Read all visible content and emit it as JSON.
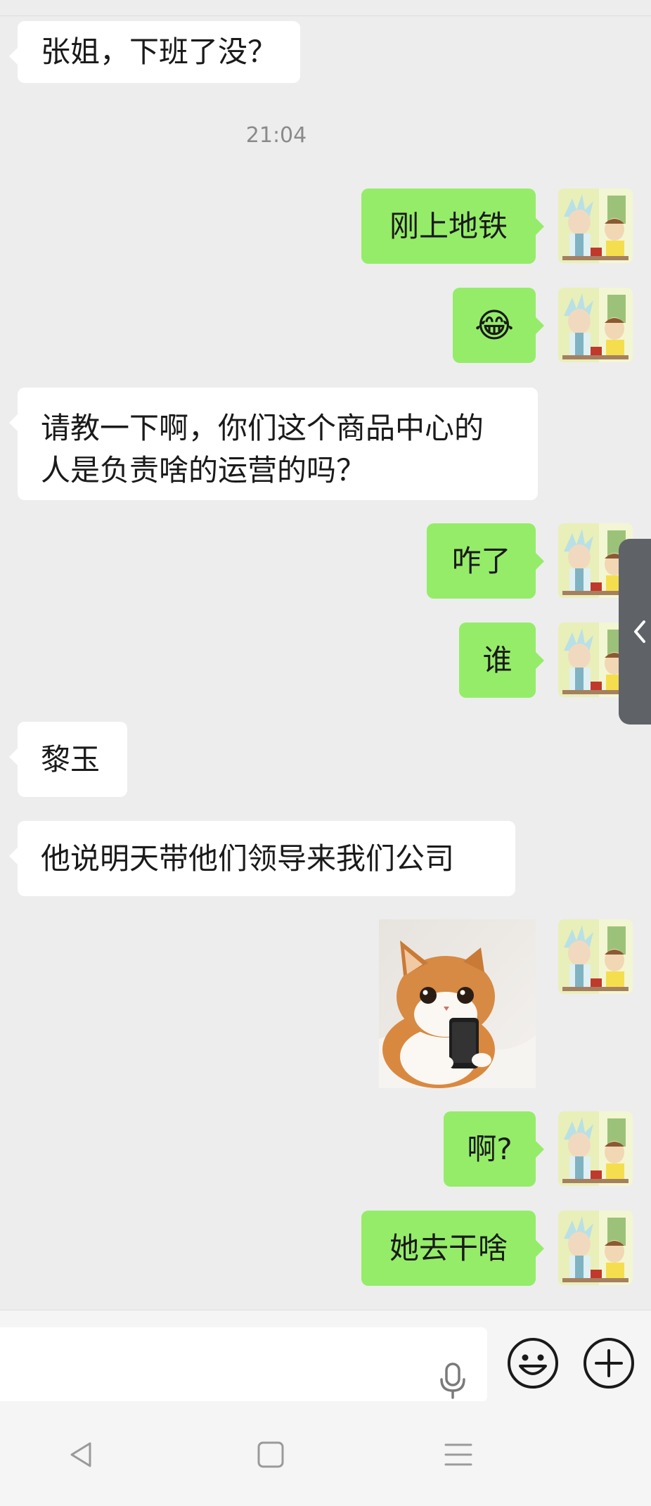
{
  "messages": [
    {
      "type": "text",
      "side": "in",
      "text": "张姐，下班了没？"
    },
    {
      "type": "timestamp",
      "text": "21:04"
    },
    {
      "type": "text",
      "side": "out",
      "text": "刚上地铁"
    },
    {
      "type": "emoji",
      "side": "out",
      "emoji": "😂"
    },
    {
      "type": "text",
      "side": "in",
      "lines": [
        "请教一下啊，你们这个商品中心的",
        "人是负责啥的运营的吗？"
      ]
    },
    {
      "type": "text",
      "side": "out",
      "text": "咋了"
    },
    {
      "type": "text",
      "side": "out",
      "text": "谁"
    },
    {
      "type": "text",
      "side": "in",
      "text": "黎玉"
    },
    {
      "type": "text",
      "side": "in",
      "text": "他说明天带他们领导来我们公司"
    },
    {
      "type": "image",
      "side": "out",
      "description": "cat-holding-phone-sticker"
    },
    {
      "type": "text",
      "side": "out",
      "text": "啊?"
    },
    {
      "type": "text",
      "side": "out",
      "text": "她去干啥"
    }
  ],
  "icons": {
    "voice": "microphone-icon",
    "emoji": "smiley-icon",
    "more": "plus-circle-icon",
    "side_tab": "chevron-left-icon",
    "nav": [
      "back-triangle-icon",
      "home-square-icon",
      "menu-lines-icon"
    ]
  },
  "colors": {
    "background": "#ededed",
    "incoming_bubble": "#ffffff",
    "outgoing_bubble": "#95ec69",
    "side_tab": "#5f6368"
  }
}
